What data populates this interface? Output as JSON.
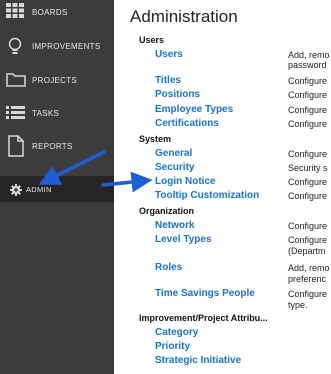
{
  "sidebar": {
    "items": [
      {
        "label": "BOARDS",
        "icon": "grid-icon"
      },
      {
        "label": "IMPROVEMENTS",
        "icon": "lightbulb-icon"
      },
      {
        "label": "PROJECTS",
        "icon": "folder-icon"
      },
      {
        "label": "TASKS",
        "icon": "list-icon"
      },
      {
        "label": "REPORTS",
        "icon": "document-icon"
      },
      {
        "label": "ADMIN",
        "icon": "gear-icon",
        "active": true
      }
    ]
  },
  "main": {
    "title": "Administration",
    "sections": [
      {
        "heading": "Users",
        "links": [
          {
            "label": "Users",
            "desc": "Add, remo",
            "desc2": "password"
          },
          {
            "label": "Titles",
            "desc": "Configure"
          },
          {
            "label": "Positions",
            "desc": "Configure"
          },
          {
            "label": "Employee Types",
            "desc": "Configure"
          },
          {
            "label": "Certifications",
            "desc": "Configure"
          }
        ]
      },
      {
        "heading": "System",
        "links": [
          {
            "label": "General",
            "desc": "Configure"
          },
          {
            "label": "Security",
            "desc": "Security s"
          },
          {
            "label": "Login Notice",
            "desc": "Configure"
          },
          {
            "label": "Tooltip Customization",
            "desc": "Configure"
          }
        ]
      },
      {
        "heading": "Organization",
        "links": [
          {
            "label": "Network",
            "desc": "Configure"
          },
          {
            "label": "Level Types",
            "desc": "Configure",
            "desc2": "(Departm"
          },
          {
            "label": "Roles",
            "desc": "Add, remo",
            "desc2": "preferenc"
          },
          {
            "label": "Time Savings People",
            "desc": "Configure",
            "desc2": "type."
          }
        ]
      },
      {
        "heading": "Improvement/Project Attribu...",
        "links": [
          {
            "label": "Category"
          },
          {
            "label": "Priority"
          },
          {
            "label": "Strategic Initiative"
          }
        ]
      }
    ]
  },
  "colors": {
    "sidebar_bg": "#3c3c3c",
    "sidebar_active_bg": "#252525",
    "link": "#1a73c6",
    "arrow": "#1f5fd6"
  }
}
